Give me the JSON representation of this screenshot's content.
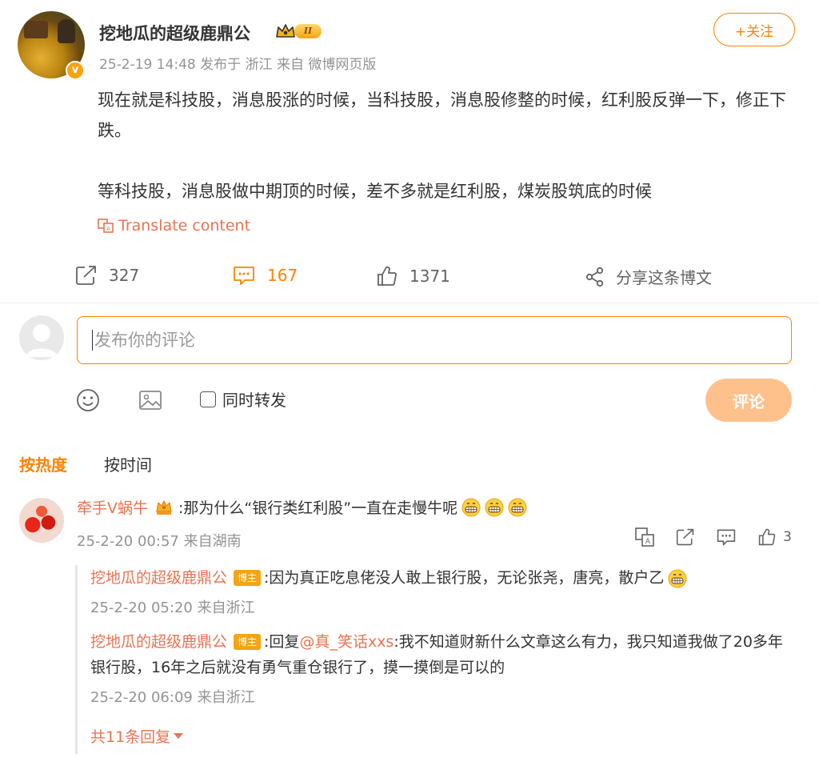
{
  "post": {
    "author": "挖地瓜的超级鹿鼎公",
    "vip_level": "II",
    "meta": "25-2-19 14:48  发布于 浙江  来自 微博网页版",
    "follow_label": "+关注",
    "paragraph1": "现在就是科技股，消息股涨的时候，当科技股，消息股修整的时候，红利股反弹一下，修正下跌。",
    "paragraph2": "等科技股，消息股做中期顶的时候，差不多就是红利股，煤炭股筑底的时候",
    "translate_label": "Translate content"
  },
  "actions": {
    "repost_count": "327",
    "comment_count": "167",
    "like_count": "1371",
    "share_label": "分享这条博文"
  },
  "composer": {
    "placeholder": "发布你的评论",
    "repost_label": "同时转发",
    "submit_label": "评论"
  },
  "sort": {
    "hot": "按热度",
    "time": "按时间"
  },
  "comment": {
    "user": "牵手V蜗牛",
    "text": ":那为什么“银行类红利股”一直在走慢牛呢",
    "emoji": "grin-emoji",
    "meta": "25-2-20 00:57 来自湖南",
    "like_count": "3"
  },
  "replies": [
    {
      "user": "挖地瓜的超级鹿鼎公",
      "tag": "博主",
      "text": ":因为真正吃息佬没人敢上银行股，无论张尧，唐亮，散户乙",
      "meta": "25-2-20 05:20 来自浙江"
    },
    {
      "user": "挖地瓜的超级鹿鼎公",
      "tag": "博主",
      "reply_prefix": ":回复",
      "mention": "@真_笑话xxs",
      "text": ":我不知道财新什么文章这么有力，我只知道我做了20多年银行股，16年之后就没有勇气重仓银行了，摸一摸倒是可以的",
      "meta": "25-2-20 06:09 来自浙江"
    }
  ],
  "more_replies": "共11条回复",
  "colors": {
    "accent": "#ff8200",
    "link": "#eb7350",
    "muted": "#939393"
  }
}
